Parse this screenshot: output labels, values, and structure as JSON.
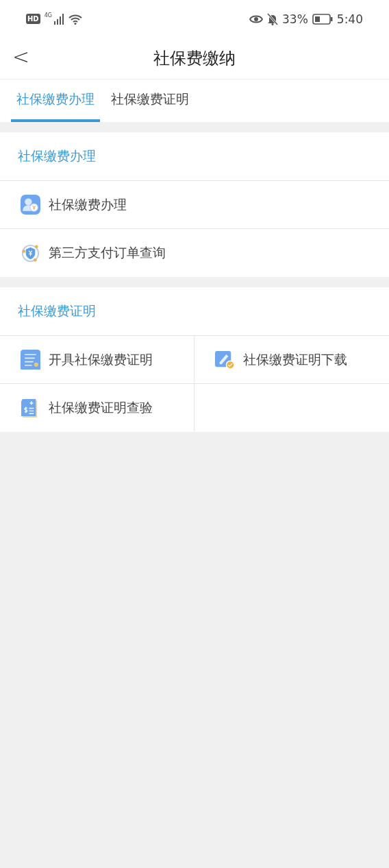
{
  "status_bar": {
    "hd": "HD",
    "network": "4G",
    "battery_text": "33%",
    "time": "5:40"
  },
  "header": {
    "back": "<",
    "title": "社保费缴纳"
  },
  "tabs": [
    {
      "label": "社保缴费办理",
      "selected": true
    },
    {
      "label": "社保缴费证明",
      "selected": false
    }
  ],
  "sections": [
    {
      "title": "社保缴费办理",
      "kind": "list",
      "items": [
        {
          "label": "社保缴费办理",
          "kind": "person"
        },
        {
          "label": "第三方支付订单查询",
          "kind": "shield"
        }
      ]
    },
    {
      "title": "社保缴费证明",
      "kind": "grid",
      "items": [
        {
          "label": "开具社保缴费证明",
          "kind": "list"
        },
        {
          "label": "社保缴费证明下载",
          "kind": "pen"
        },
        {
          "label": "社保缴费证明查验",
          "kind": "bill"
        }
      ]
    }
  ]
}
